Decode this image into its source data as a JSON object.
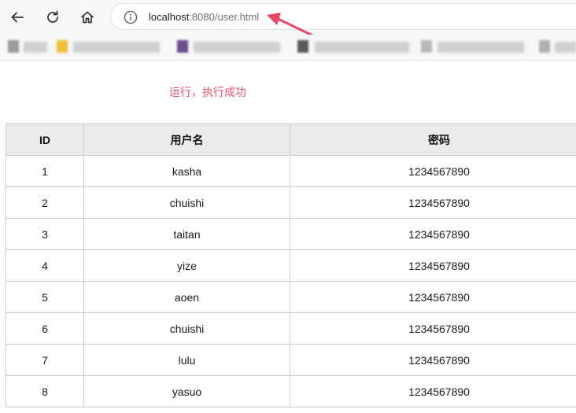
{
  "browser": {
    "url_host": "localhost",
    "url_rest": ":8080/user.html",
    "icons": {
      "back": "arrow-left-icon",
      "reload": "reload-icon",
      "home": "home-icon",
      "info": "info-icon",
      "annotation": "red-arrow-icon"
    }
  },
  "page": {
    "message": "运行，执行成功",
    "message_color": "#ef4f6b",
    "table": {
      "headers": [
        "ID",
        "用户名",
        "密码"
      ],
      "rows": [
        [
          "1",
          "kasha",
          "1234567890"
        ],
        [
          "2",
          "chuishi",
          "1234567890"
        ],
        [
          "3",
          "taitan",
          "1234567890"
        ],
        [
          "4",
          "yize",
          "1234567890"
        ],
        [
          "5",
          "aoen",
          "1234567890"
        ],
        [
          "6",
          "chuishi",
          "1234567890"
        ],
        [
          "7",
          "lulu",
          "1234567890"
        ],
        [
          "8",
          "yasuo",
          "1234567890"
        ]
      ]
    }
  }
}
